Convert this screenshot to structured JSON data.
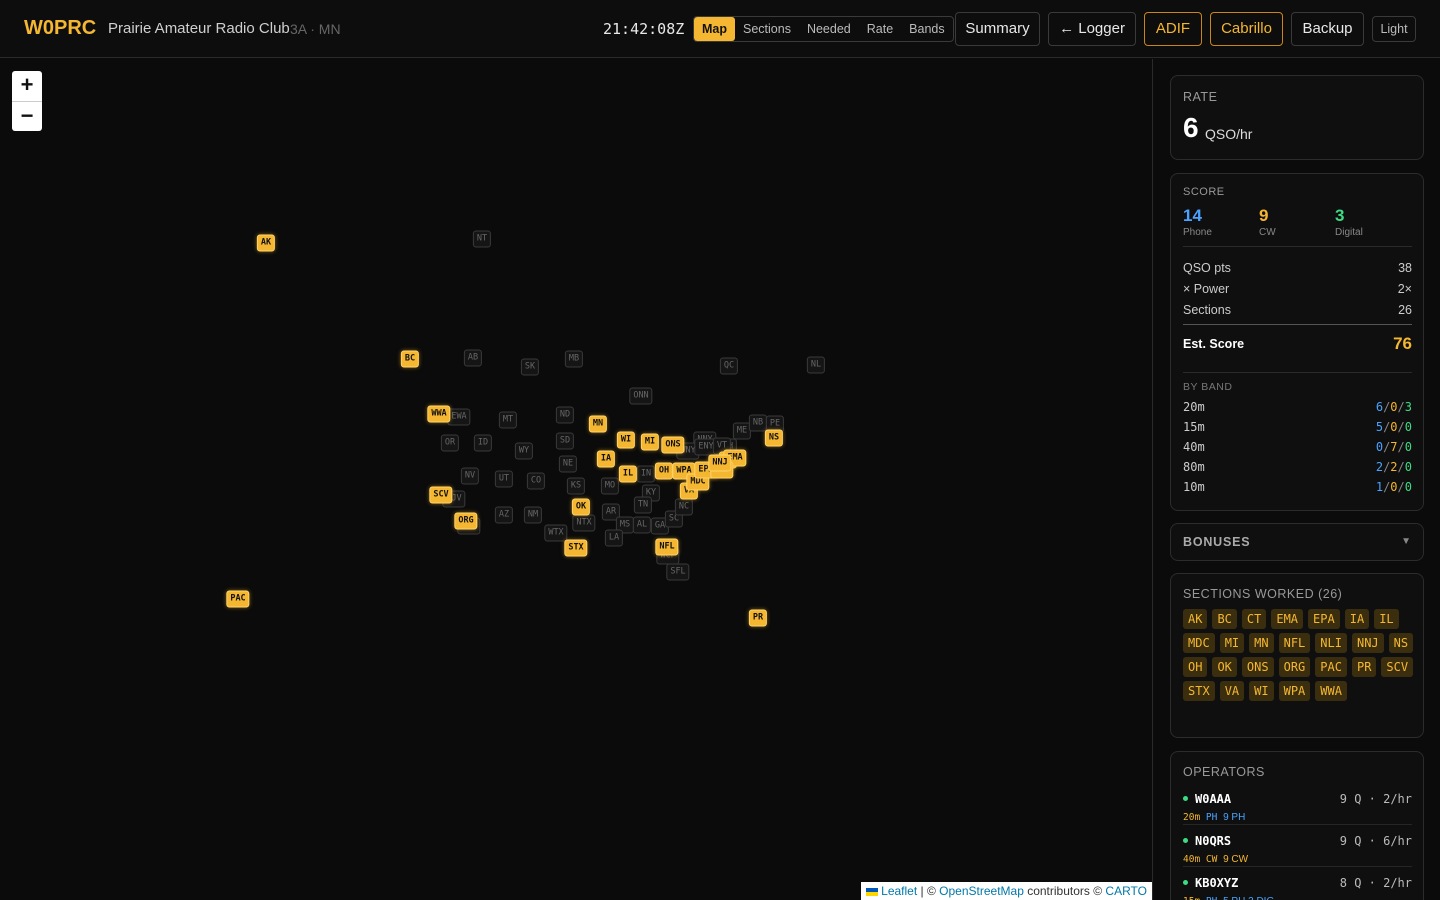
{
  "header": {
    "callsign": "W0PRC",
    "club_name": "Prairie Amateur Radio Club",
    "class_section": "3A · MN",
    "clock": "21:42:08Z",
    "view_tabs": [
      "Map",
      "Sections",
      "Needed",
      "Rate",
      "Bands"
    ],
    "active_tab": "Map",
    "buttons": {
      "summary": "Summary",
      "logger": "← Logger",
      "adif": "ADIF",
      "cabrillo": "Cabrillo",
      "backup": "Backup",
      "theme": "Light"
    }
  },
  "map": {
    "zoom_in": "+",
    "zoom_out": "−",
    "attribution": {
      "leaflet": "Leaflet",
      "sep": " | © ",
      "osm": "OpenStreetMap",
      "contrib": " contributors © ",
      "carto": "CARTO"
    },
    "worked_markers": [
      "AK",
      "BC",
      "WWA",
      "MN",
      "WI",
      "MI",
      "IA",
      "IL",
      "OH",
      "WPA",
      "VA",
      "MDC",
      "OK",
      "STX",
      "SCV",
      "ORG",
      "NFL",
      "PAC",
      "PR",
      "NS",
      "ONS",
      "CT",
      "EMA",
      "EPA",
      "NLI",
      "NNJ"
    ],
    "unworked_markers": [
      "NT",
      "AB",
      "SK",
      "MB",
      "QC",
      "NL",
      "EWA",
      "MT",
      "ND",
      "ONN",
      "OR",
      "ID",
      "SD",
      "WY",
      "NE",
      "NV",
      "UT",
      "CO",
      "KS",
      "MO",
      "IN",
      "KY",
      "TN",
      "AR",
      "SJV",
      "AZ",
      "NM",
      "NTX",
      "MS",
      "AL",
      "GA",
      "SC",
      "NC",
      "WTX",
      "LA",
      "SDG",
      "WCF",
      "SFL",
      "NNY",
      "WNY",
      "ENY",
      "NH",
      "VT",
      "ME",
      "NB",
      "PE"
    ]
  },
  "rate": {
    "label": "RATE",
    "value": "6",
    "unit": "QSO/hr"
  },
  "score": {
    "label": "SCORE",
    "modes": [
      {
        "value": "14",
        "name": "Phone",
        "color": "#4aa3ff"
      },
      {
        "value": "9",
        "name": "CW",
        "color": "#f5b731"
      },
      {
        "value": "3",
        "name": "Digital",
        "color": "#3ddc84"
      }
    ],
    "rows": [
      {
        "label": "QSO pts",
        "value": "38"
      },
      {
        "label": "× Power",
        "value": "2×"
      },
      {
        "label": "Sections",
        "value": "26"
      }
    ],
    "est_label": "Est. Score",
    "est_value": "76",
    "by_band_label": "BY BAND",
    "bands": [
      {
        "band": "20m",
        "phone": "6",
        "cw": "0",
        "digital": "3"
      },
      {
        "band": "15m",
        "phone": "5",
        "cw": "0",
        "digital": "0"
      },
      {
        "band": "40m",
        "phone": "0",
        "cw": "7",
        "digital": "0"
      },
      {
        "band": "80m",
        "phone": "2",
        "cw": "2",
        "digital": "0"
      },
      {
        "band": "10m",
        "phone": "1",
        "cw": "0",
        "digital": "0"
      }
    ]
  },
  "bonuses": {
    "label": "BONUSES",
    "chevron": "▼"
  },
  "sections_worked": {
    "label": "SECTIONS WORKED (26)",
    "items": [
      "AK",
      "BC",
      "CT",
      "EMA",
      "EPA",
      "IA",
      "IL",
      "MDC",
      "MI",
      "MN",
      "NFL",
      "NLI",
      "NNJ",
      "NS",
      "OH",
      "OK",
      "ONS",
      "ORG",
      "PAC",
      "PR",
      "SCV",
      "STX",
      "VA",
      "WI",
      "WPA",
      "WWA"
    ]
  },
  "operators": {
    "label": "OPERATORS",
    "items": [
      {
        "call": "W0AAA",
        "stat": "9 Q · 2/hr",
        "band": "20m",
        "mode": "PH",
        "detail": "9 PH",
        "color": "#4aa3ff"
      },
      {
        "call": "N0QRS",
        "stat": "9 Q · 6/hr",
        "band": "40m",
        "mode": "CW",
        "detail": "9 CW",
        "color": "#f5b731"
      },
      {
        "call": "KB0XYZ",
        "stat": "8 Q · 2/hr",
        "band": "15m",
        "mode": "PH",
        "detail": "5 PH  3 DIG",
        "color": "#4aa3ff"
      }
    ]
  }
}
